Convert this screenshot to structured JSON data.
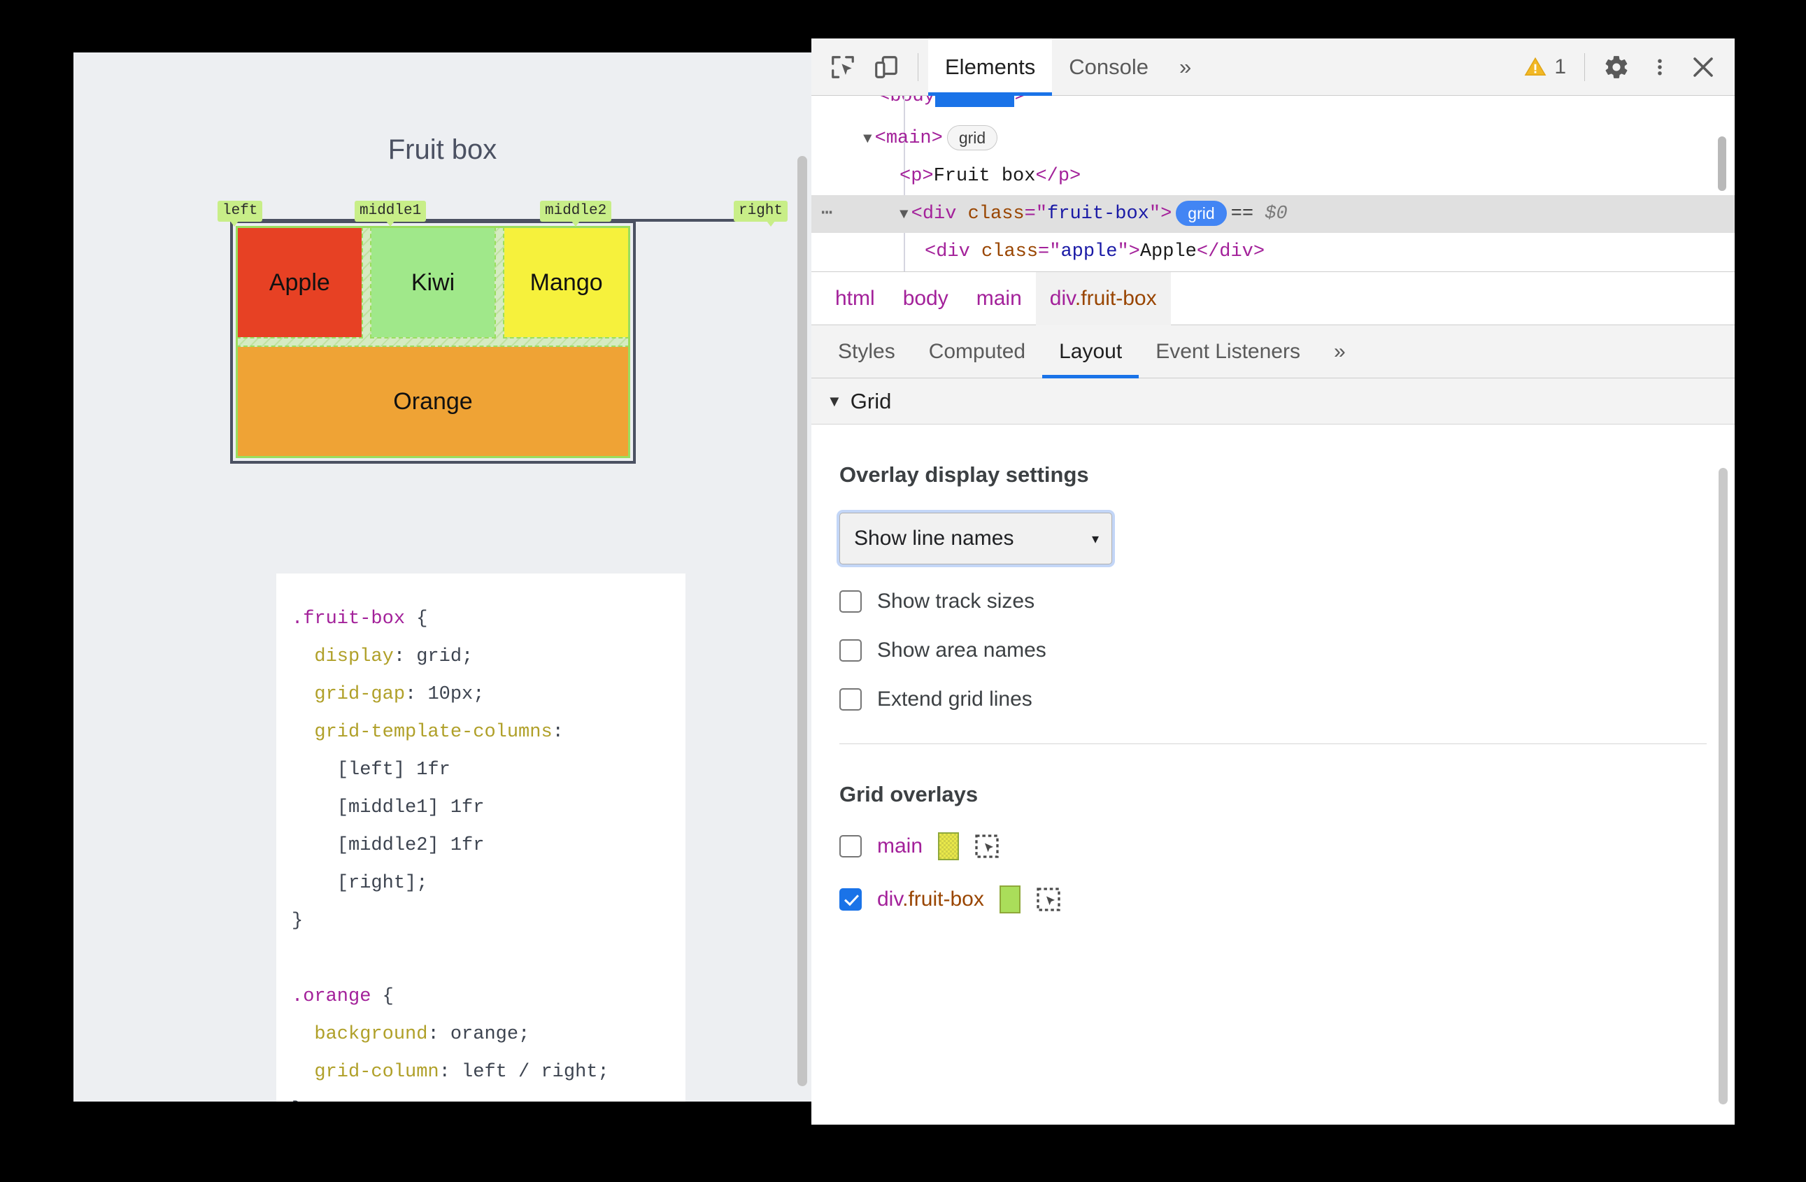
{
  "page": {
    "title": "Fruit box",
    "grid_line_names": [
      "left",
      "middle1",
      "middle2",
      "right"
    ],
    "cells": [
      {
        "label": "Apple",
        "color": "#e74124"
      },
      {
        "label": "Kiwi",
        "color": "#a0e88a"
      },
      {
        "label": "Mango",
        "color": "#f6f13c"
      },
      {
        "label": "Orange",
        "color": "#efa335"
      }
    ],
    "code": {
      "rule1_selector": ".fruit-box",
      "rule1_lines": [
        {
          "prop": "display",
          "value": "grid"
        },
        {
          "prop": "grid-gap",
          "value": "10px"
        },
        {
          "prop": "grid-template-columns",
          "value": ""
        }
      ],
      "rule1_columns": [
        "[left] 1fr",
        "[middle1] 1fr",
        "[middle2] 1fr",
        "[right];"
      ],
      "rule2_selector": ".orange",
      "rule2_lines": [
        {
          "prop": "background",
          "value": "orange"
        },
        {
          "prop": "grid-column",
          "value": "left / right"
        }
      ]
    }
  },
  "devtools": {
    "toolbar": {
      "inspect_icon": "inspect-cursor-icon",
      "device_icon": "device-toolbar-icon",
      "tabs": [
        {
          "label": "Elements",
          "active": true
        },
        {
          "label": "Console",
          "active": false
        }
      ],
      "more_tabs": "»",
      "warning_count": "1",
      "settings_icon": "gear-icon",
      "menu_icon": "kebab-menu-icon",
      "close_icon": "close-icon"
    },
    "dom_tree": {
      "partial_top": "body",
      "rows": [
        {
          "type": "main_open",
          "tag": "main",
          "badge": "grid"
        },
        {
          "type": "p_line",
          "text": "Fruit box",
          "tag": "p"
        },
        {
          "type": "div_open",
          "tag": "div",
          "attr": "class",
          "value": "fruit-box",
          "badge": "grid",
          "eq": "==",
          "dollar": "$0",
          "selected": true
        },
        {
          "type": "div_leaf",
          "tag": "div",
          "attr": "class",
          "value": "apple",
          "text": "Apple"
        }
      ]
    },
    "breadcrumb": [
      {
        "label": "html",
        "active": false
      },
      {
        "label": "body",
        "active": false
      },
      {
        "label": "main",
        "active": false
      },
      {
        "label": "div",
        "cls": ".fruit-box",
        "active": true
      }
    ],
    "subtabs": [
      {
        "label": "Styles",
        "active": false
      },
      {
        "label": "Computed",
        "active": false
      },
      {
        "label": "Layout",
        "active": true
      },
      {
        "label": "Event Listeners",
        "active": false
      }
    ],
    "subtabs_more": "»",
    "grid_section": {
      "title": "Grid",
      "caret": "▼",
      "overlay_settings_title": "Overlay display settings",
      "select_value": "Show line names",
      "select_caret": "▾",
      "checkboxes": [
        {
          "label": "Show track sizes",
          "checked": false
        },
        {
          "label": "Show area names",
          "checked": false
        },
        {
          "label": "Extend grid lines",
          "checked": false
        }
      ],
      "overlays_title": "Grid overlays",
      "overlays": [
        {
          "name": "main",
          "cls": "",
          "checked": false,
          "swatch": "checkered",
          "swatch_color": "#e9e84a"
        },
        {
          "name": "div",
          "cls": ".fruit-box",
          "checked": true,
          "swatch": "solid",
          "swatch_color": "#aade5a"
        }
      ]
    }
  }
}
